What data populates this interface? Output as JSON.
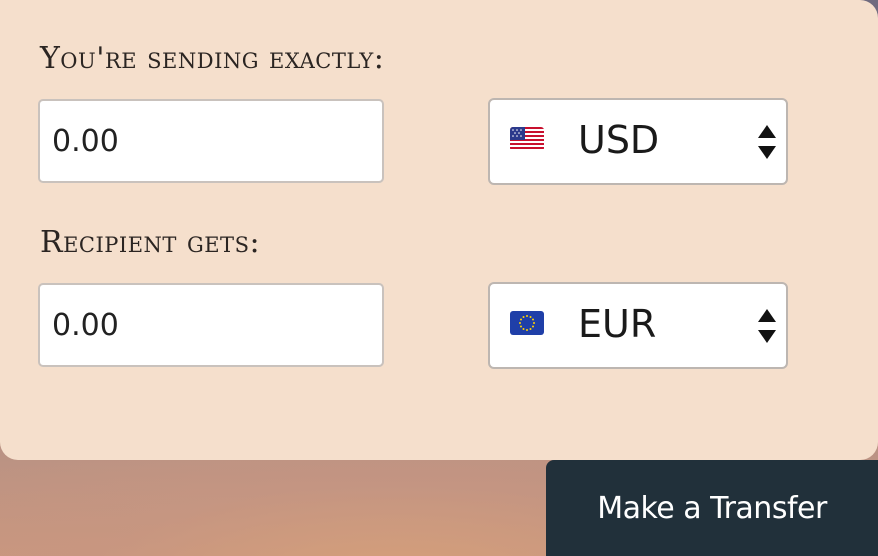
{
  "form": {
    "send_label": "You're sending exactly:",
    "send_amount": "0.00",
    "send_currency": {
      "code": "USD",
      "flag_icon": "us-flag-icon"
    },
    "receive_label": "Recipient gets:",
    "receive_amount": "0.00",
    "receive_currency": {
      "code": "EUR",
      "flag_icon": "eu-flag-icon"
    }
  },
  "actions": {
    "transfer_label": "Make a Transfer"
  },
  "colors": {
    "card_background": "#f5dfcc",
    "button_background": "#21303a",
    "text": "#2b2522"
  }
}
